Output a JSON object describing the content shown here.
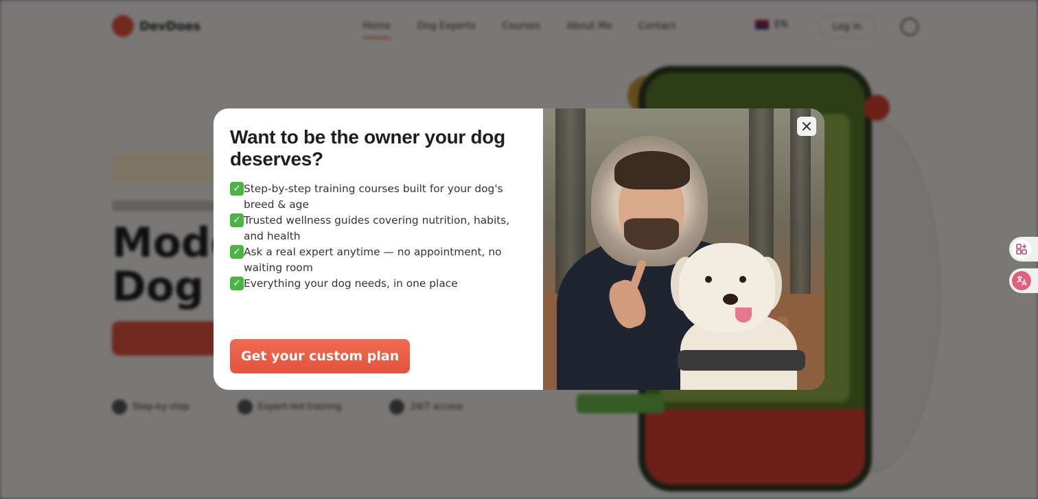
{
  "background_page": {
    "brand": "DevDoes",
    "nav": [
      "Home",
      "Dog Experts",
      "Courses",
      "About Me",
      "Contact"
    ],
    "language": "EN",
    "login_label": "Log in",
    "headline": [
      "Modern",
      "Dog T"
    ],
    "features": [
      "Step-by-step",
      "Expert-led training",
      "24/7 access"
    ]
  },
  "modal": {
    "title": "Want to be the owner your dog deserves?",
    "benefits": [
      "Step-by-step training courses built for your dog's breed & age",
      "Trusted wellness guides covering nutrition, habits, and health",
      "Ask a real expert anytime — no appointment, no waiting room",
      "Everything your dog needs, in one place"
    ],
    "cta_label": "Get your custom plan",
    "close_icon": "close-icon",
    "check_icon": "check-mark-emoji-icon",
    "photo": "man-with-golden-retriever-photo"
  },
  "side_widgets": [
    "apps-sparkle-icon",
    "translate-icon"
  ],
  "colors": {
    "accent": "#e6533d",
    "check_green": "#4bb543",
    "overlay": "rgba(0,0,0,0.5)"
  }
}
